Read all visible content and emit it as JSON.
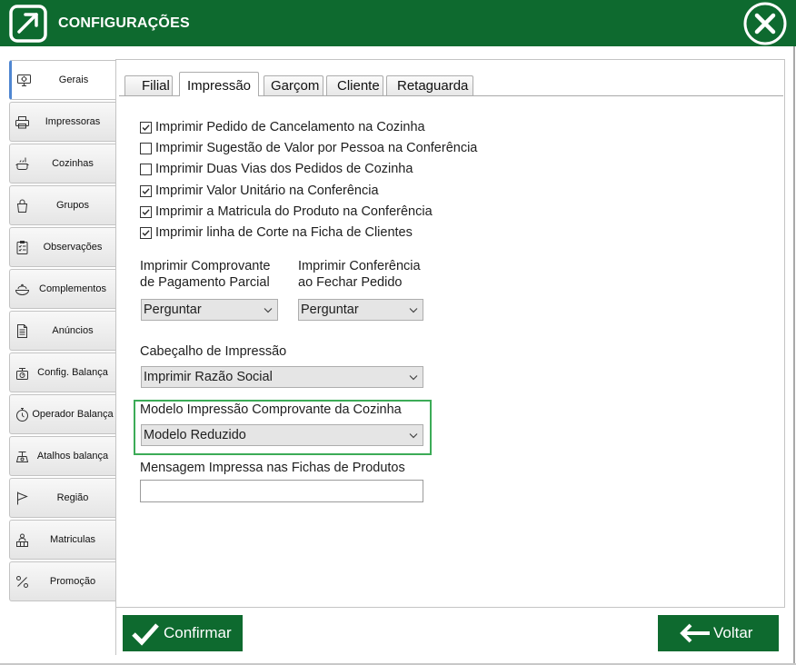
{
  "window": {
    "title": "CONFIGURAÇÕES",
    "logo_icon": "app-logo-icon",
    "close_icon": "close-circle-icon"
  },
  "colors": {
    "header_bg": "#0e6a2f",
    "button_bg": "#0e6a2f",
    "highlight_border": "#3cab57",
    "selected_accent": "#4f86d1"
  },
  "sidebar": {
    "items": [
      {
        "label": "Gerais",
        "icon": "settings-monitor-icon",
        "selected": true
      },
      {
        "label": "Impressoras",
        "icon": "printer-icon",
        "selected": false
      },
      {
        "label": "Cozinhas",
        "icon": "kitchen-icon",
        "selected": false
      },
      {
        "label": "Grupos",
        "icon": "grocery-bag-icon",
        "selected": false
      },
      {
        "label": "Observações",
        "icon": "checklist-icon",
        "selected": false
      },
      {
        "label": "Complementos",
        "icon": "food-bowl-icon",
        "selected": false
      },
      {
        "label": "Anúncios",
        "icon": "document-icon",
        "selected": false
      },
      {
        "label": "Config. Balança",
        "icon": "scale-icon",
        "selected": false
      },
      {
        "label": "Operador Balança",
        "icon": "stopwatch-icon",
        "selected": false
      },
      {
        "label": "Atalhos balança",
        "icon": "scale-shortcut-icon",
        "selected": false
      },
      {
        "label": "Região",
        "icon": "flag-icon",
        "selected": false
      },
      {
        "label": "Matriculas",
        "icon": "registration-icon",
        "selected": false
      },
      {
        "label": "Promoção",
        "icon": "promotion-icon",
        "selected": false
      }
    ]
  },
  "tabs": [
    {
      "label": "Filial",
      "selected": false
    },
    {
      "label": "Impressão",
      "selected": true
    },
    {
      "label": "Garçom",
      "selected": false
    },
    {
      "label": "Cliente",
      "selected": false
    },
    {
      "label": "Retaguarda",
      "selected": false
    }
  ],
  "options": [
    {
      "label": "Imprimir Pedido de Cancelamento na Cozinha",
      "checked": true
    },
    {
      "label": "Imprimir Sugestão de Valor por Pessoa na Conferência",
      "checked": false
    },
    {
      "label": "Imprimir Duas Vias dos Pedidos de Cozinha",
      "checked": false
    },
    {
      "label": "Imprimir Valor Unitário na Conferência",
      "checked": true
    },
    {
      "label": "Imprimir a Matricula do Produto na Conferência",
      "checked": true
    },
    {
      "label": "Imprimir linha de Corte na Ficha de Clientes",
      "checked": true
    }
  ],
  "fields": {
    "comprovante_parcial": {
      "label_line1": "Imprimir Comprovante",
      "label_line2": "de Pagamento Parcial",
      "value": "Perguntar"
    },
    "conferencia_fechar": {
      "label_line1": "Imprimir Conferência",
      "label_line2": "ao Fechar Pedido",
      "value": "Perguntar"
    },
    "cabecalho": {
      "label": "Cabeçalho de Impressão",
      "value": "Imprimir Razão Social"
    },
    "modelo_cozinha": {
      "label": "Modelo Impressão Comprovante da Cozinha",
      "value": "Modelo Reduzido"
    },
    "mensagem_fichas": {
      "label": "Mensagem Impressa nas Fichas de Produtos",
      "value": ""
    }
  },
  "footer": {
    "confirm_label": "Confirmar",
    "confirm_icon": "checkmark-icon",
    "back_label": "Voltar",
    "back_icon": "arrow-left-icon"
  }
}
